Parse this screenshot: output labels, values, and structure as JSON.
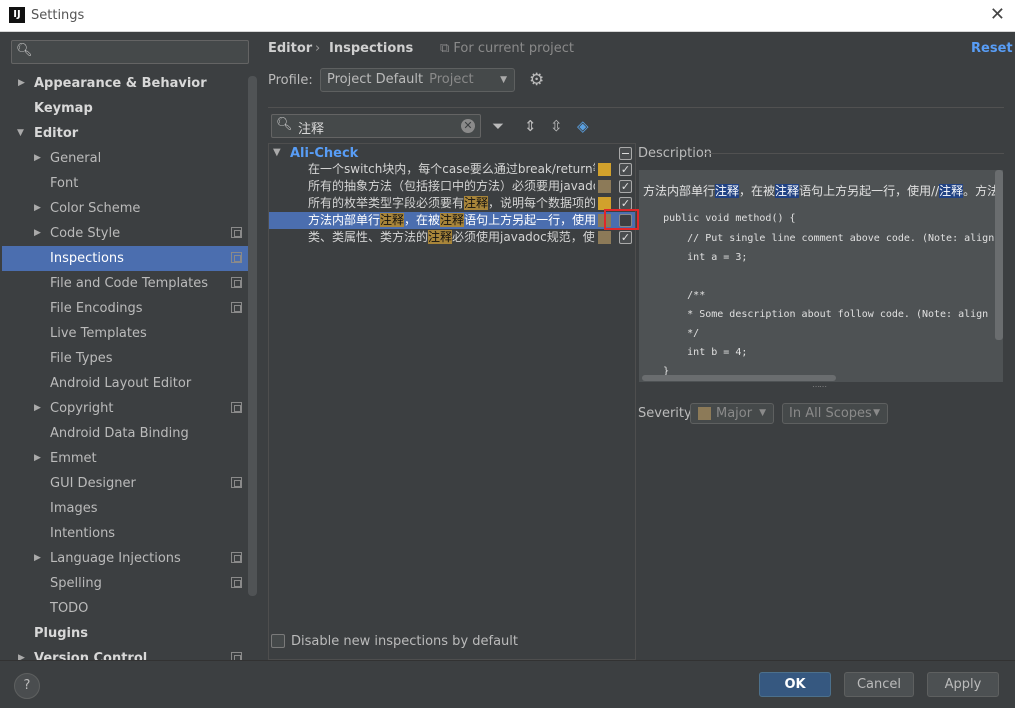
{
  "window": {
    "app_icon": "IJ",
    "title": "Settings",
    "close": "✕"
  },
  "sidebar": {
    "search": {
      "placeholder": ""
    },
    "items": [
      {
        "label": "Appearance & Behavior",
        "arrow": "▶"
      },
      {
        "label": "Keymap"
      },
      {
        "label": "Editor",
        "arrow": "▼"
      },
      {
        "label": "General",
        "arrow": "▶"
      },
      {
        "label": "Font"
      },
      {
        "label": "Color Scheme",
        "arrow": "▶"
      },
      {
        "label": "Code Style",
        "arrow": "▶"
      },
      {
        "label": "Inspections"
      },
      {
        "label": "File and Code Templates"
      },
      {
        "label": "File Encodings"
      },
      {
        "label": "Live Templates"
      },
      {
        "label": "File Types"
      },
      {
        "label": "Android Layout Editor"
      },
      {
        "label": "Copyright",
        "arrow": "▶"
      },
      {
        "label": "Android Data Binding"
      },
      {
        "label": "Emmet",
        "arrow": "▶"
      },
      {
        "label": "GUI Designer"
      },
      {
        "label": "Images"
      },
      {
        "label": "Intentions"
      },
      {
        "label": "Language Injections",
        "arrow": "▶"
      },
      {
        "label": "Spelling"
      },
      {
        "label": "TODO"
      },
      {
        "label": "Plugins"
      },
      {
        "label": "Version Control",
        "arrow": "▶"
      }
    ]
  },
  "header": {
    "breadcrumb": [
      "Editor",
      "›",
      "Inspections"
    ],
    "for_project": "For current project",
    "reset": "Reset"
  },
  "profile": {
    "label": "Profile:",
    "value": "Project Default",
    "sub": "Project"
  },
  "filter": {
    "value": "注释"
  },
  "inspections": {
    "group": "Ali-Check",
    "rows": [
      {
        "pre": "在一个switch块内，每个case要么通过break/return等来终止，要么注释说明程序将继续执行到哪一个case为止",
        "hl": "",
        "post": "",
        "severity_color": "#d1a12c",
        "checked": "✓"
      },
      {
        "pre": "所有的抽象方法（包括接口中的方法）必须要用javadoc注释",
        "hl": "",
        "post": "",
        "severity_color": "#8c7a58",
        "checked": "✓"
      },
      {
        "pre": "所有的枚举类型字段必须要有",
        "hl": "注释",
        "post": "，说明每个数据项的用途",
        "severity_color": "#d1a12c",
        "checked": "✓"
      },
      {
        "pre": "方法内部单行",
        "hl": "注释",
        "mid": "，在被",
        "hl2": "注释",
        "post": "语句上方另起一行，使用//注释",
        "severity_color": "#8c7a58",
        "checked": ""
      },
      {
        "pre": "类、类属性、类方法的",
        "hl": "注释",
        "post": "必须使用javadoc规范，使用/**内容*/格式",
        "severity_color": "#8c7a58",
        "checked": "✓"
      }
    ]
  },
  "disable_new": {
    "label": "Disable new inspections by default"
  },
  "description": {
    "label": "Description",
    "text_parts": [
      "方法内部单行",
      "注释",
      "，在被",
      "注释",
      "语句上方另起一行，使用//",
      "注释",
      "。方法"
    ],
    "code_lines": [
      "    public void method() {",
      "        // Put single line comment above code. (Note: align",
      "        int a = 3;",
      "",
      "        /**",
      "        * Some description about follow code. (Note: align",
      "        */",
      "        int b = 4;",
      "    }"
    ]
  },
  "severity": {
    "label": "Severity:",
    "value": "Major",
    "swatch": "#8c7a58",
    "scope": "In All Scopes"
  },
  "footer": {
    "help": "?",
    "ok": "OK",
    "cancel": "Cancel",
    "apply": "Apply"
  },
  "colors": {
    "accent": "#589df6",
    "selection": "#4b6eaf",
    "primary_button": "#365880",
    "highlight": "#a8853a"
  }
}
